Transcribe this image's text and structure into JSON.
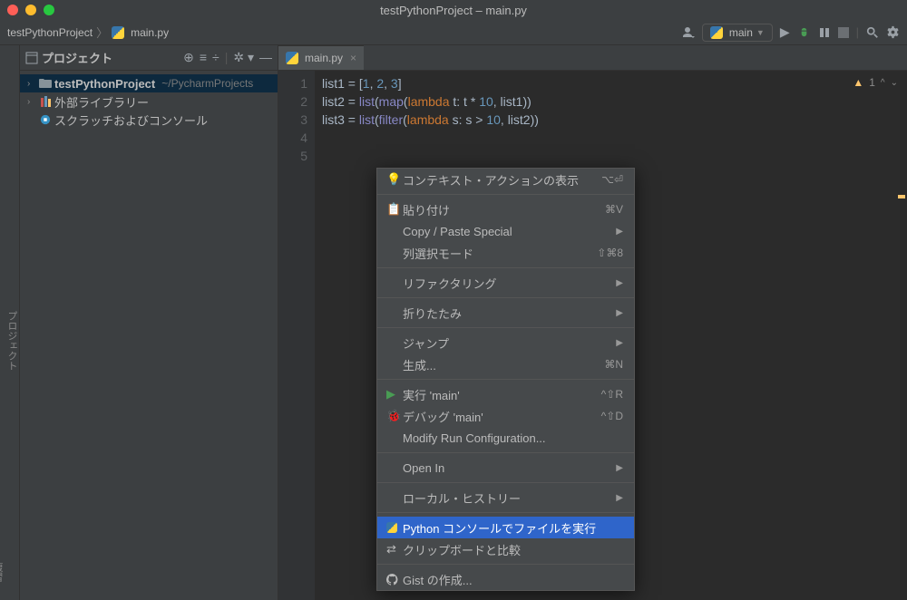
{
  "window": {
    "title": "testPythonProject – main.py"
  },
  "breadcrumb": {
    "project": "testPythonProject",
    "file": "main.py"
  },
  "runConfig": {
    "name": "main"
  },
  "sidebar": {
    "title": "プロジェクト",
    "items": [
      {
        "label": "testPythonProject",
        "path": "~/PycharmProjects"
      },
      {
        "label": "外部ライブラリー"
      },
      {
        "label": "スクラッチおよびコンソール"
      }
    ]
  },
  "tab": {
    "name": "main.py"
  },
  "code": {
    "lines": [
      "1",
      "2",
      "3",
      "4",
      "5"
    ],
    "l1_var": "list1",
    "l1_eq": " = [",
    "l1_n1": "1",
    "l1_n2": "2",
    "l1_n3": "3",
    "l1_close": "]",
    "l2_var": "list2",
    "l2_eq": " = ",
    "l2_fn1": "list",
    "l2_p1": "(",
    "l2_fn2": "map",
    "l2_p2": "(",
    "l2_kw": "lambda ",
    "l2_t": "t: t * ",
    "l2_ten": "10",
    "l2_rest": ", list1))",
    "l3_var": "list3",
    "l3_eq": " = ",
    "l3_fn1": "list",
    "l3_p1": "(",
    "l3_fn2": "filter",
    "l3_p2": "(",
    "l3_kw": "lambda ",
    "l3_s": "s: s > ",
    "l3_ten": "10",
    "l3_rest": ", list2))"
  },
  "inspection": {
    "count": "1"
  },
  "leftGutter": {
    "project": "プロジェクト",
    "bottom": "復習"
  },
  "menu": {
    "contextActions": {
      "label": "コンテキスト・アクションの表示",
      "shortcut": "⌥⏎"
    },
    "paste": {
      "label": "貼り付け",
      "shortcut": "⌘V"
    },
    "copyPaste": {
      "label": "Copy / Paste Special"
    },
    "columnSelect": {
      "label": "列選択モード",
      "shortcut": "⇧⌘8"
    },
    "refactoring": {
      "label": "リファクタリング"
    },
    "folding": {
      "label": "折りたたみ"
    },
    "jump": {
      "label": "ジャンプ"
    },
    "generate": {
      "label": "生成...",
      "shortcut": "⌘N"
    },
    "run": {
      "label": "実行 'main'",
      "shortcut": "^⇧R"
    },
    "debug": {
      "label": "デバッグ 'main'",
      "shortcut": "^⇧D"
    },
    "modifyRun": {
      "label": "Modify Run Configuration..."
    },
    "openIn": {
      "label": "Open In"
    },
    "localHistory": {
      "label": "ローカル・ヒストリー"
    },
    "runConsole": {
      "label": "Python コンソールでファイルを実行"
    },
    "compareClipboard": {
      "label": "クリップボードと比較"
    },
    "createGist": {
      "label": "Gist の作成..."
    }
  }
}
